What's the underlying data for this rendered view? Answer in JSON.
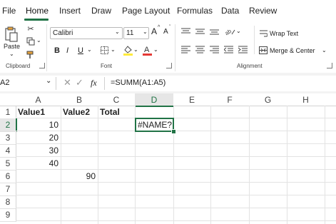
{
  "menu": {
    "items": [
      "File",
      "Home",
      "Insert",
      "Draw",
      "Page Layout",
      "Formulas",
      "Data",
      "Review"
    ],
    "active": "Home"
  },
  "ribbon": {
    "clipboard": {
      "paste_label": "Paste",
      "group_label": "Clipboard"
    },
    "font": {
      "font_name": "Calibri",
      "font_size": "11",
      "bold": "B",
      "italic": "I",
      "underline": "U",
      "grow": "A",
      "shrink": "A",
      "group_label": "Font"
    },
    "alignment": {
      "wrap_text": "Wrap Text",
      "merge_center": "Merge & Center",
      "group_label": "Alignment"
    }
  },
  "formula_bar": {
    "name_box": "A2",
    "fx": "fx",
    "formula": "=SUMM(A1:A5)"
  },
  "sheet": {
    "columns": [
      "A",
      "B",
      "C",
      "D",
      "E",
      "F",
      "G",
      "H"
    ],
    "rows": [
      "1",
      "2",
      "3",
      "4",
      "5",
      "6",
      "7",
      "8",
      "9"
    ],
    "cells": {
      "A1": "Value1",
      "B1": "Value2",
      "C1": "Total",
      "A2": "10",
      "A3": "20",
      "A4": "30",
      "A5": "40",
      "B6": "90",
      "D2": "#NAME?"
    },
    "selected_cell": "D2",
    "accent": "#217346"
  }
}
